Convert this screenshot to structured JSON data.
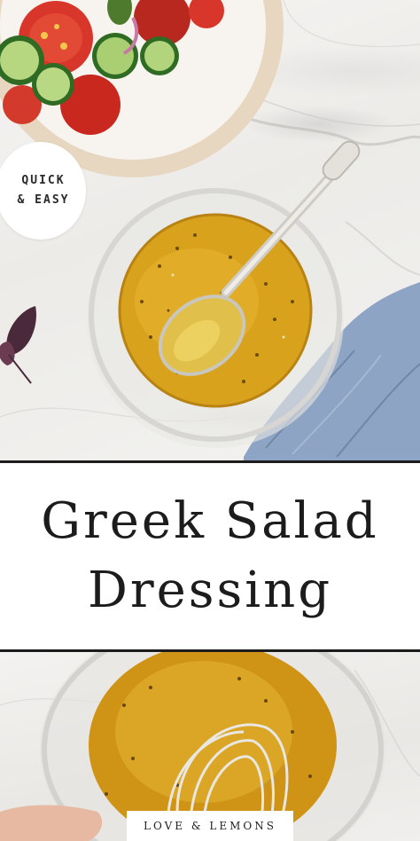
{
  "badge": {
    "line1": "QUICK",
    "line2": "& EASY"
  },
  "title": {
    "line1": "Greek Salad",
    "line2": "Dressing"
  },
  "brand": {
    "label": "LOVE & LEMONS"
  },
  "colors": {
    "marble": "#f2f1ef",
    "dressing": "#d8a21c",
    "tomato": "#d8362a",
    "cucumber": "#7fb04a",
    "text": "#1c1c1c",
    "towel": "#8ea4c4"
  },
  "icons": [
    "salad-plate",
    "basil-leaf",
    "glass-bowl",
    "spoon",
    "napkin",
    "whisk"
  ]
}
